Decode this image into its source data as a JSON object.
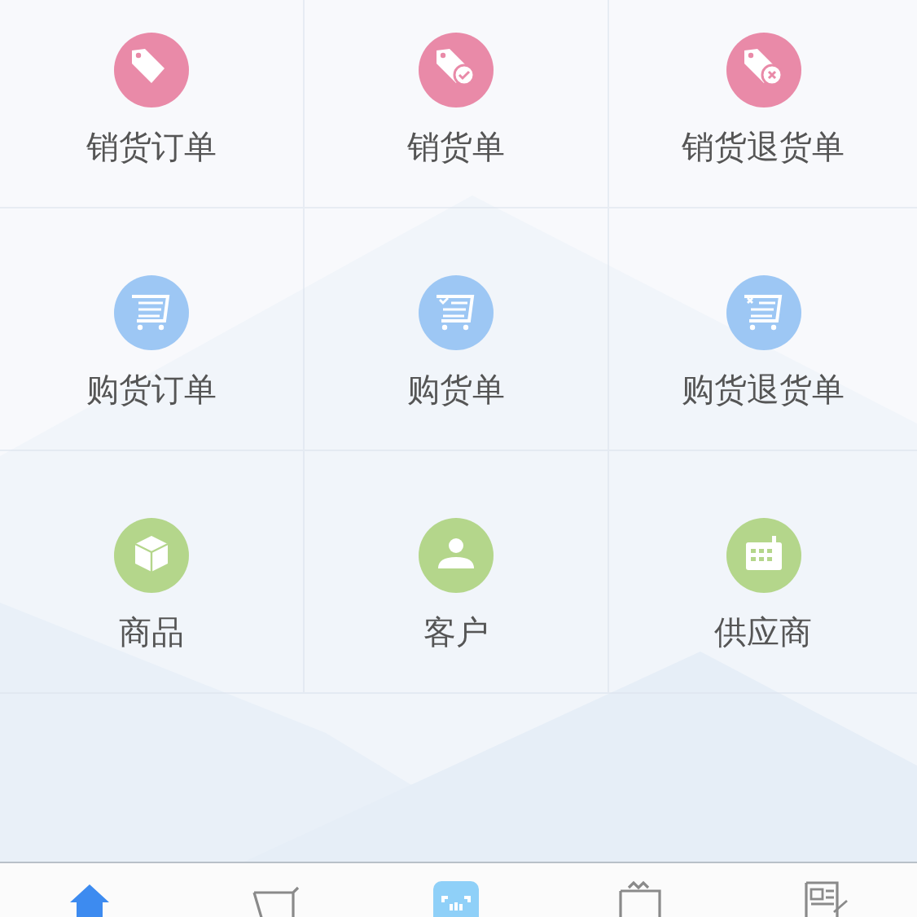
{
  "grid": [
    {
      "label": "销货订单",
      "kind": "tag",
      "color": "#e98aa8"
    },
    {
      "label": "销货单",
      "kind": "tag-check",
      "color": "#e98aa8"
    },
    {
      "label": "销货退货单",
      "kind": "tag-cross",
      "color": "#e98aa8"
    },
    {
      "label": "购货订单",
      "kind": "cart",
      "color": "#9dc7f4"
    },
    {
      "label": "购货单",
      "kind": "cart-check",
      "color": "#9dc7f4"
    },
    {
      "label": "购货退货单",
      "kind": "cart-cross",
      "color": "#9dc7f4"
    },
    {
      "label": "商品",
      "kind": "box",
      "color": "#b4d68b"
    },
    {
      "label": "客户",
      "kind": "person",
      "color": "#b4d68b"
    },
    {
      "label": "供应商",
      "kind": "calendar",
      "color": "#b4d68b"
    }
  ],
  "tabbar": [
    {
      "kind": "home",
      "selected": true
    },
    {
      "kind": "cart",
      "selected": false
    },
    {
      "kind": "scan",
      "selected": false
    },
    {
      "kind": "wallet",
      "selected": false
    },
    {
      "kind": "document",
      "selected": false
    }
  ]
}
